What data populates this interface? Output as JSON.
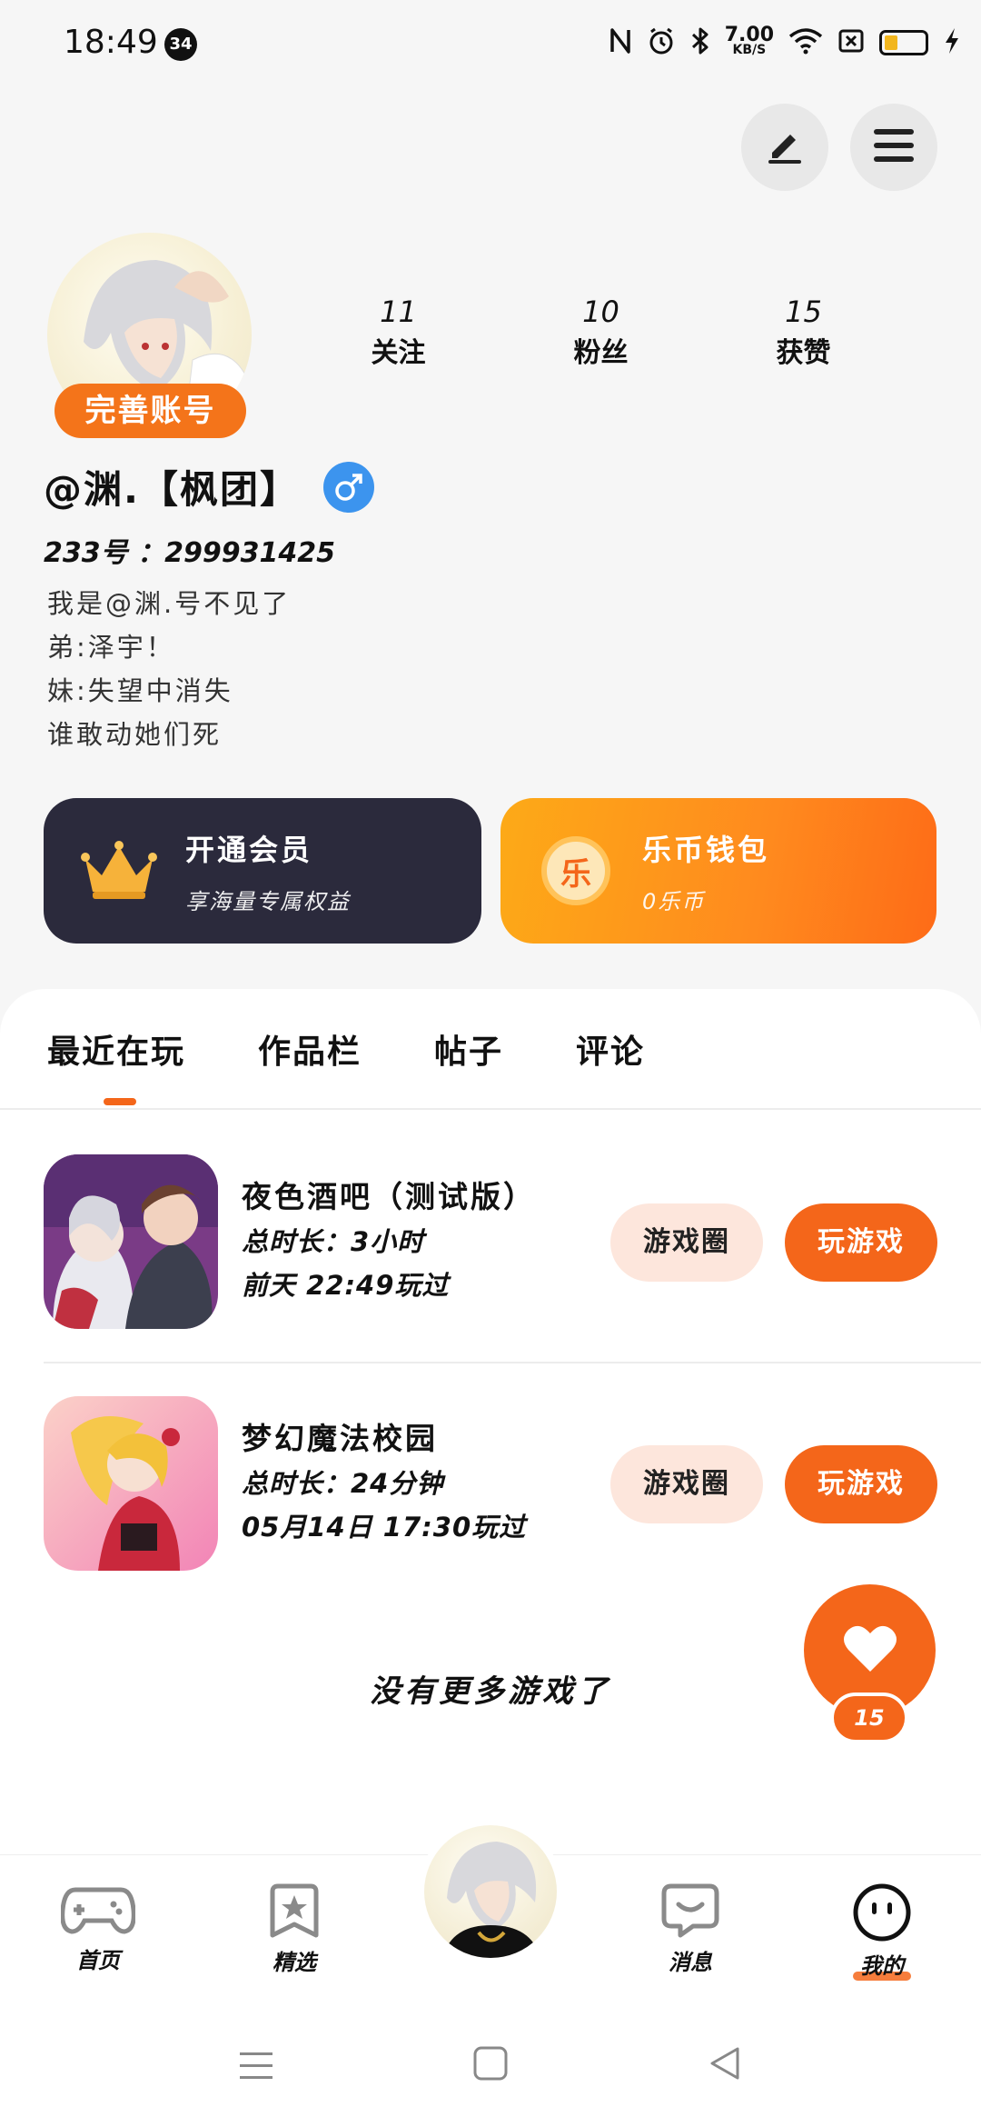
{
  "status_bar": {
    "time": "18:49",
    "badge": "34",
    "speed_value": "7.00",
    "speed_unit": "KB/S"
  },
  "header": {
    "edit_icon": "edit-pen-icon",
    "menu_icon": "hamburger-menu-icon"
  },
  "profile": {
    "complete_account_label": "完善账号",
    "username": "@渊.【枫团】",
    "gender": "male",
    "uid_label": "233号",
    "uid_value": "299931425",
    "bio": [
      "我是@渊.号不见了",
      "弟:泽宇！",
      "妹:失望中消失",
      "谁敢动她们死"
    ],
    "stats": [
      {
        "value": "11",
        "label": "关注"
      },
      {
        "value": "10",
        "label": "粉丝"
      },
      {
        "value": "15",
        "label": "获赞"
      }
    ]
  },
  "cards": {
    "vip": {
      "title": "开通会员",
      "subtitle": "享海量专属权益",
      "icon": "crown-icon"
    },
    "wallet": {
      "title": "乐币钱包",
      "subtitle": "0乐币",
      "icon_text": "乐"
    }
  },
  "tabs": [
    {
      "label": "最近在玩",
      "active": true
    },
    {
      "label": "作品栏",
      "active": false
    },
    {
      "label": "帖子",
      "active": false
    },
    {
      "label": "评论",
      "active": false
    }
  ],
  "games": [
    {
      "title": "夜色酒吧（测试版）",
      "duration": "总时长：3小时",
      "last_played": "前天 22:49玩过",
      "circle_label": "游戏圈",
      "play_label": "玩游戏"
    },
    {
      "title": "梦幻魔法校园",
      "duration": "总时长：24分钟",
      "last_played": "05月14日 17:30玩过",
      "circle_label": "游戏圈",
      "play_label": "玩游戏"
    }
  ],
  "no_more_text": "没有更多游戏了",
  "like_fab": {
    "count": "15"
  },
  "bottom_nav": [
    {
      "label": "首页",
      "icon": "gamepad-icon"
    },
    {
      "label": "精选",
      "icon": "star-bookmark-icon"
    },
    {
      "label": "消息",
      "icon": "message-bubble-icon"
    },
    {
      "label": "我的",
      "icon": "face-icon"
    }
  ],
  "colors": {
    "accent": "#f4661a",
    "vip_card": "#2b2a3c",
    "gender_blue": "#3c94ee"
  }
}
